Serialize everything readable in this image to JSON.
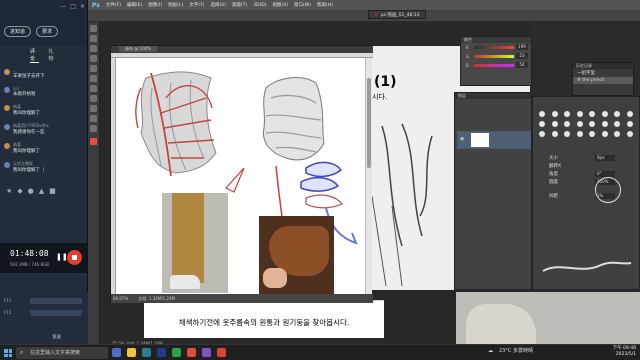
{
  "stream_panel": {
    "buttons": [
      "进知道",
      "要求"
    ],
    "tabs": [
      "评论",
      "礼物"
    ],
    "chat": [
      {
        "name": "...",
        "msg": "羊果鼠子去开下"
      },
      {
        "name": "Lin",
        "msg": "永刚开始啦"
      },
      {
        "name": "纳某",
        "msg": "我叫你理解了"
      },
      {
        "name": "纳某用户7905vdhs",
        "msg": "我感谢你在一些"
      },
      {
        "name": "纳某",
        "msg": "我叫你理解了"
      },
      {
        "name": "元学主播家",
        "msg": "我叫你理解了（"
      }
    ],
    "rec_time": "01:48:08",
    "rec_size": "592.3MB / 746.8GB",
    "bottom_label_1": "F11",
    "bottom_label_2": "F12",
    "send_label": "发送"
  },
  "photoshop": {
    "menu": [
      "Ps",
      "文件(F)",
      "编辑(E)",
      "图像(I)",
      "图层(L)",
      "文字(Y)",
      "选择(S)",
      "滤镜(T)",
      "3D(D)",
      "视图(V)",
      "窗口(W)",
      "帮助(H)"
    ],
    "doc_title": "ps 图画_01_48:10",
    "main_tab": "画布 @ 100%",
    "main_status_zoom": "66.67%",
    "main_status_doc": "文档: 1.24M/1.24M",
    "bg_big_text": "(1)",
    "bg_kr_text": "시다.",
    "bottom_caption": "채색하기전에 옷주름속의 원통과 원기둥을 찾아봅시다.",
    "bottom_status": "75.5%  文档: 1.24M/1.24M",
    "color_panel": {
      "title": "颜色",
      "rows": [
        {
          "label": "R",
          "value": "199"
        },
        {
          "label": "G",
          "value": "53"
        },
        {
          "label": "B",
          "value": "54"
        }
      ]
    },
    "history_panel": {
      "title": "历史记录",
      "items": [
        "一组字里",
        "# the pencil"
      ]
    },
    "layers_title": "图层",
    "brush_settings": [
      {
        "label": "大小",
        "value": "9px"
      },
      {
        "label": "翻转X",
        "value": ""
      },
      {
        "label": "角度",
        "value": "0°"
      },
      {
        "label": "圆度",
        "value": "100%"
      },
      {
        "label": "间距",
        "value": "1%"
      }
    ]
  },
  "taskbar": {
    "search_placeholder": "在这里输入文字来搜索",
    "weather": "23°C 多雲時晴",
    "time": "下午 09:48",
    "date": "2023/5/1"
  }
}
